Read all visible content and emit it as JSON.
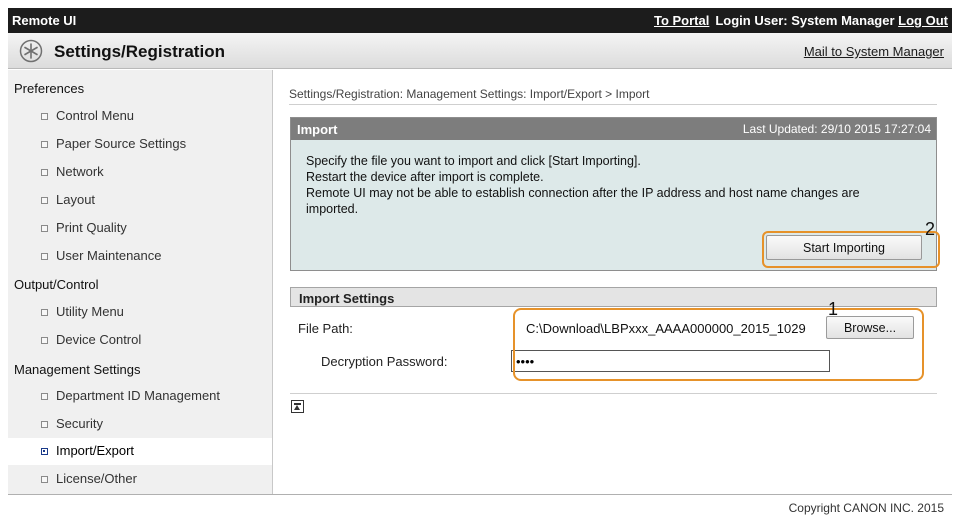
{
  "topbar": {
    "title": "Remote UI",
    "portal_link": "To Portal",
    "login_prefix": "Login User:",
    "user_name": "System Manager",
    "logout_link": "Log Out"
  },
  "header": {
    "title": "Settings/Registration",
    "mail_link": "Mail to System Manager",
    "icon": "settings-asterisk-icon"
  },
  "sidebar": {
    "groups": [
      {
        "heading": "Preferences",
        "items": [
          {
            "label": "Control Menu"
          },
          {
            "label": "Paper Source Settings"
          },
          {
            "label": "Network"
          },
          {
            "label": "Layout"
          },
          {
            "label": "Print Quality"
          },
          {
            "label": "User Maintenance"
          }
        ]
      },
      {
        "heading": "Output/Control",
        "items": [
          {
            "label": "Utility Menu"
          },
          {
            "label": "Device Control"
          }
        ]
      },
      {
        "heading": "Management Settings",
        "items": [
          {
            "label": "Department ID Management"
          },
          {
            "label": "Security"
          },
          {
            "label": "Import/Export",
            "active": true
          },
          {
            "label": "License/Other"
          }
        ]
      }
    ]
  },
  "breadcrumb": "Settings/Registration: Management Settings: Import/Export > Import",
  "import_panel": {
    "title": "Import",
    "last_updated": "Last Updated: 29/10 2015 17:27:04",
    "lines": [
      "Specify the file you want to import and click [Start Importing].",
      "Restart the device after import is complete.",
      "Remote UI may not be able to establish connection after the IP address and host name changes are",
      "imported."
    ],
    "start_button": "Start Importing",
    "marker": "2"
  },
  "import_settings": {
    "title": "Import Settings",
    "file_path_label": "File Path:",
    "file_path_value": "C:\\Download\\LBPxxx_AAAA000000_2015_1029",
    "browse_button": "Browse...",
    "password_label": "Decryption Password:",
    "password_value": "••••",
    "marker": "1"
  },
  "footer": {
    "copyright": "Copyright CANON INC. 2015"
  },
  "colors": {
    "topbar_bg": "#1c1c1c",
    "panel_bg": "#dde9e9",
    "panel_bar": "#7d7d7d",
    "highlight": "#e6922a"
  }
}
